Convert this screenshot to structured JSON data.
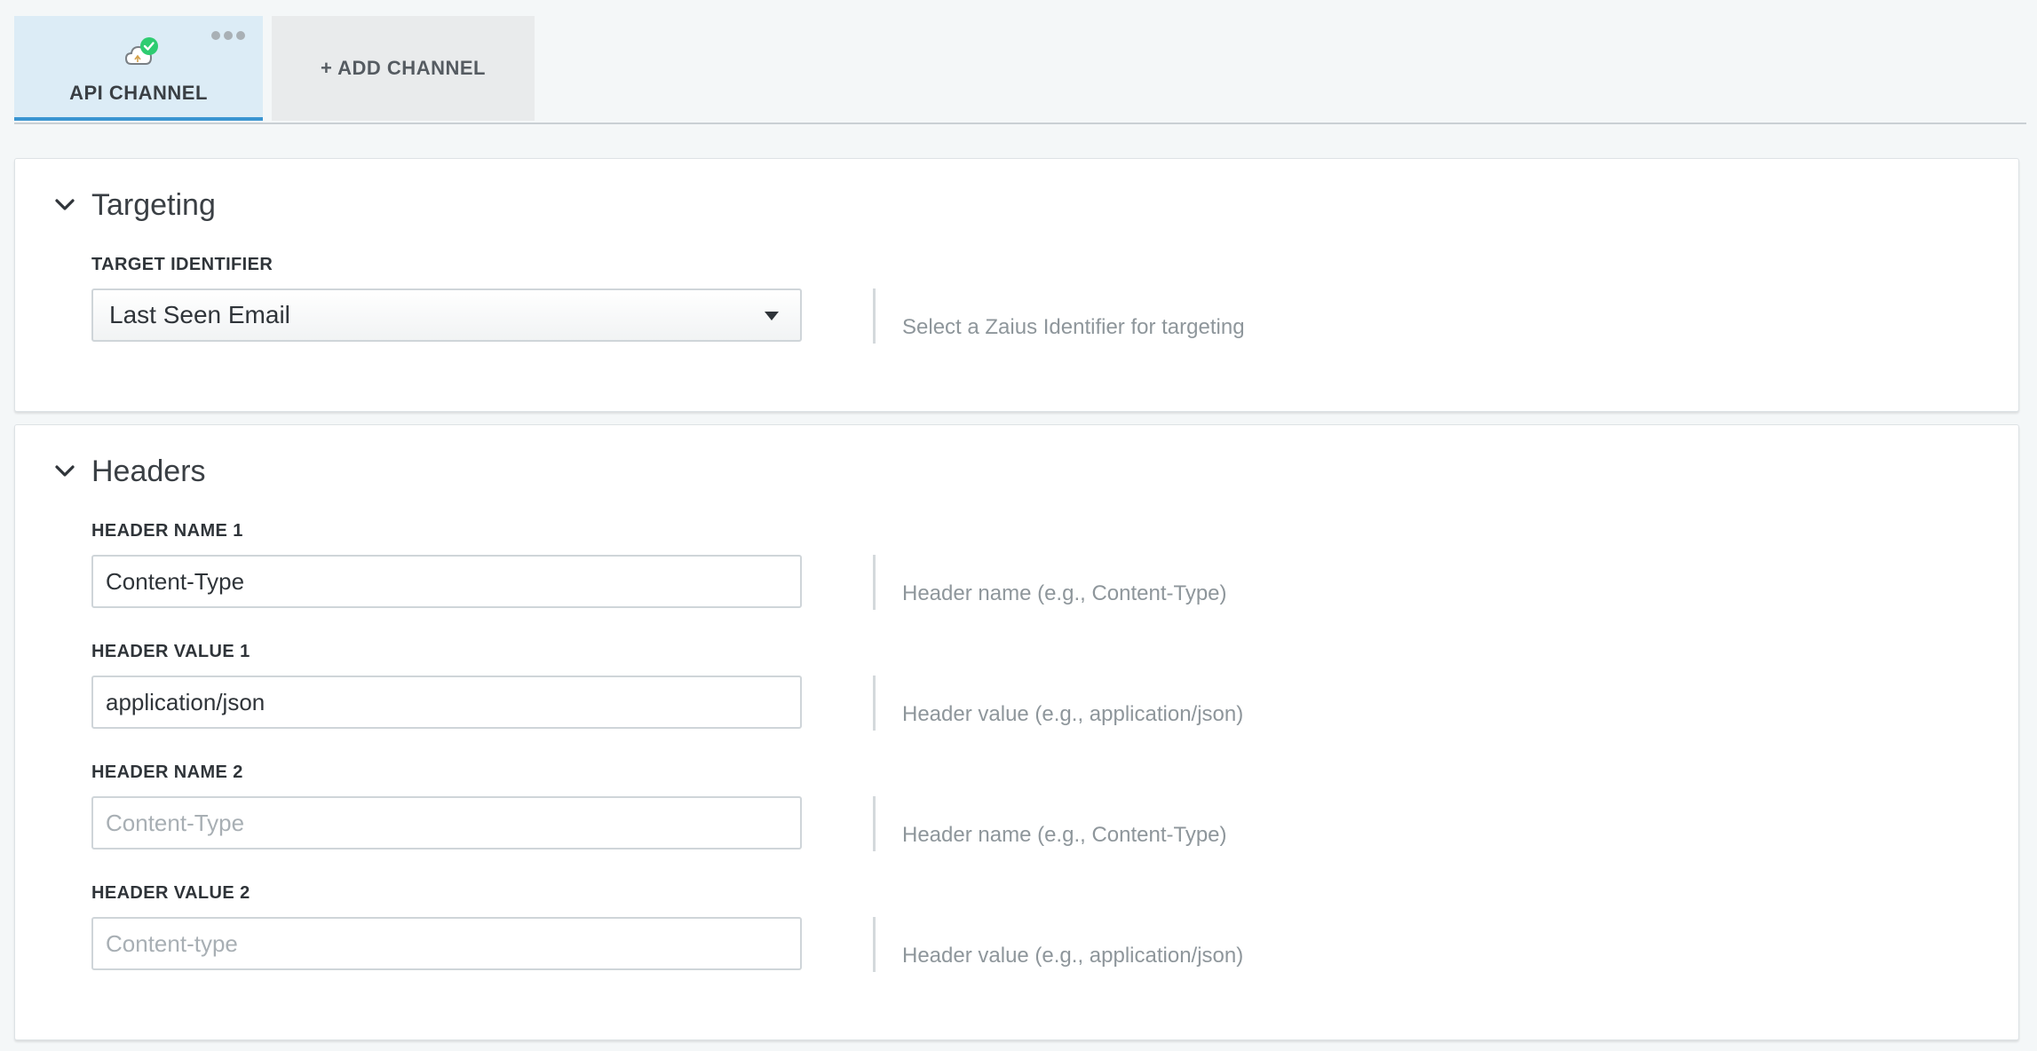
{
  "tabs": {
    "api_channel": {
      "label": "API CHANNEL",
      "icon": "cloud-check-icon",
      "status_color": "#2ecc71"
    },
    "add_channel": {
      "label": "+ ADD CHANNEL"
    }
  },
  "targeting": {
    "title": "Targeting",
    "target_identifier": {
      "label": "TARGET IDENTIFIER",
      "selected": "Last Seen Email",
      "help": "Select a Zaius Identifier for targeting"
    }
  },
  "headers": {
    "title": "Headers",
    "fields": [
      {
        "label": "HEADER NAME 1",
        "value": "Content-Type",
        "placeholder": "",
        "help": "Header name (e.g., Content-Type)"
      },
      {
        "label": "HEADER VALUE 1",
        "value": "application/json",
        "placeholder": "",
        "help": "Header value (e.g., application/json)"
      },
      {
        "label": "HEADER NAME 2",
        "value": "",
        "placeholder": "Content-Type",
        "help": "Header name (e.g., Content-Type)"
      },
      {
        "label": "HEADER VALUE 2",
        "value": "",
        "placeholder": "Content-type",
        "help": "Header value (e.g., application/json)"
      }
    ]
  },
  "colors": {
    "accent": "#3a95d1",
    "active_tab_bg": "#dcecf6",
    "success": "#2ecc71"
  }
}
